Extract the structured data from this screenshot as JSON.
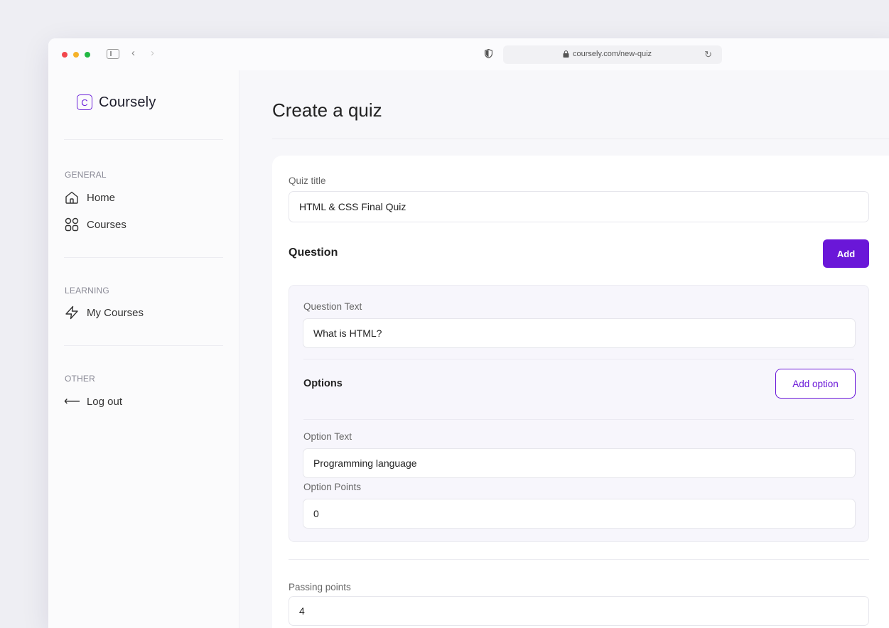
{
  "browser": {
    "url": "coursely.com/new-quiz"
  },
  "sidebar": {
    "logo_mark": "C",
    "logo_text": "Coursely",
    "sections": [
      {
        "title": "GENERAL",
        "items": [
          {
            "label": "Home",
            "icon": "home-icon"
          },
          {
            "label": "Courses",
            "icon": "grid-icon"
          }
        ]
      },
      {
        "title": "LEARNING",
        "items": [
          {
            "label": "My Courses",
            "icon": "lightning-icon"
          }
        ]
      },
      {
        "title": "OTHER",
        "items": [
          {
            "label": "Log out",
            "icon": "arrow-left-icon"
          }
        ]
      }
    ]
  },
  "main": {
    "title": "Create a quiz",
    "quiz_title_label": "Quiz title",
    "quiz_title_value": "HTML & CSS Final Quiz",
    "question_heading": "Question",
    "add_button": "Add",
    "question": {
      "text_label": "Question Text",
      "text_value": "What is HTML?",
      "options_heading": "Options",
      "add_option_button": "Add option",
      "option_text_label": "Option Text",
      "option_text_value": "Programming language",
      "option_points_label": "Option Points",
      "option_points_value": "0"
    },
    "passing_points_label": "Passing points",
    "passing_points_value": "4"
  },
  "colors": {
    "accent": "#6a17d8",
    "page_background": "#eeeef3",
    "sidebar_background": "#fbfbfc",
    "main_background": "#f7f7fa"
  }
}
